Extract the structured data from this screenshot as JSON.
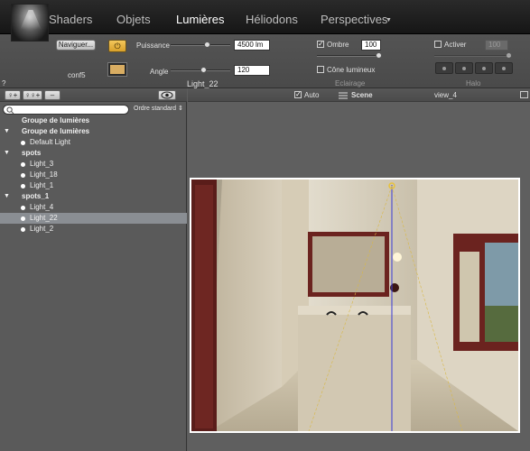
{
  "top_tabs": [
    "Shaders",
    "Objets",
    "Lumières",
    "Héliodons",
    "Perspectives"
  ],
  "toolbar": {
    "navigate_label": "Naviguer...",
    "preset_name": "conf5",
    "question": "?",
    "puissance_label": "Puissance",
    "puissance_value": "4500 lm",
    "angle_label": "Angle",
    "angle_value": "120",
    "light_name": "Light_22",
    "ombre_label": "Ombre",
    "ombre_value": "100",
    "cone_label": "Cône lumineux",
    "eclairage_label": "Eclairage",
    "activer_label": "Activer",
    "halo_value": "100",
    "halo_label": "Halo",
    "power_icon": "⏻",
    "check_mark": "✓"
  },
  "left_panel": {
    "add_light_icon": "♀+",
    "add_group_icon": "♀♀+",
    "remove_label": "–",
    "order_label": "Ordre standard ⇕",
    "expanded_icon": "▼",
    "tree": [
      {
        "label": "Groupe de lumières",
        "type": "group",
        "expanded": false
      },
      {
        "label": "Groupe de lumières",
        "type": "group",
        "expanded": true
      },
      {
        "label": "Default Light",
        "type": "light"
      },
      {
        "label": "spots",
        "type": "group",
        "expanded": true
      },
      {
        "label": "Light_3",
        "type": "light"
      },
      {
        "label": "Light_18",
        "type": "light"
      },
      {
        "label": "Light_1",
        "type": "light"
      },
      {
        "label": "spots_1",
        "type": "group",
        "expanded": true
      },
      {
        "label": "Light_4",
        "type": "light"
      },
      {
        "label": "Light_22",
        "type": "light",
        "selected": true
      },
      {
        "label": "Light_2",
        "type": "light"
      }
    ]
  },
  "viewport_bar": {
    "auto_label": "Auto",
    "scene_label": "Scene",
    "view_label": "view_4"
  }
}
